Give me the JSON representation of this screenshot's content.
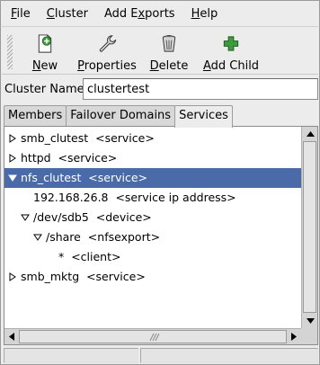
{
  "menubar": {
    "items": [
      {
        "mnemonic": "F",
        "rest": "ile"
      },
      {
        "mnemonic": "C",
        "rest": "luster"
      },
      {
        "pre": "Add E",
        "mnemonic": "x",
        "rest": "ports"
      },
      {
        "mnemonic": "H",
        "rest": "elp"
      }
    ]
  },
  "toolbar": {
    "new": {
      "mnemonic": "N",
      "rest": "ew",
      "icon": "new-icon"
    },
    "properties": {
      "mnemonic": "P",
      "rest": "roperties",
      "icon": "wrench-icon"
    },
    "delete": {
      "mnemonic": "D",
      "rest": "elete",
      "icon": "trash-icon"
    },
    "add_child": {
      "mnemonic": "A",
      "rest": "dd Child",
      "icon": "plus-icon"
    }
  },
  "cluster_name": {
    "label": "Cluster Name:",
    "value": "clustertest"
  },
  "tabs": [
    {
      "label": "Members",
      "active": false
    },
    {
      "label": "Failover Domains",
      "active": false
    },
    {
      "label": "Services",
      "active": true
    }
  ],
  "tree": [
    {
      "text": "smb_clutest  <service>",
      "level": 0,
      "expander": "collapsed",
      "selected": false
    },
    {
      "text": "httpd  <service>",
      "level": 0,
      "expander": "collapsed",
      "selected": false
    },
    {
      "text": "nfs_clutest  <service>",
      "level": 0,
      "expander": "expanded",
      "selected": true
    },
    {
      "text": "192.168.26.8  <service ip address>",
      "level": 1,
      "expander": "none",
      "selected": false
    },
    {
      "text": "/dev/sdb5  <device>",
      "level": 1,
      "expander": "expanded",
      "selected": false
    },
    {
      "text": "/share  <nfsexport>",
      "level": 2,
      "expander": "expanded",
      "selected": false
    },
    {
      "text": "*  <client>",
      "level": 3,
      "expander": "none",
      "selected": false
    },
    {
      "text": "smb_mktg  <service>",
      "level": 0,
      "expander": "collapsed",
      "selected": false
    }
  ],
  "colors": {
    "selection": "#4a6ba8",
    "plus_icon": "#3d9a3d"
  }
}
